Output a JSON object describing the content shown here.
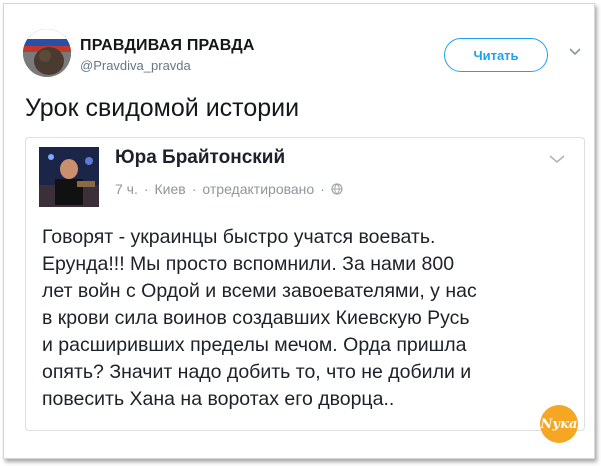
{
  "tweet": {
    "author_name": "ПРАВДИВАЯ ПРАВДА",
    "author_handle": "@Pravdiva_pravda",
    "follow_label": "Читать",
    "text": "Урок свидомой истории"
  },
  "facebook_post": {
    "author_name": "Юра Брайтонский",
    "time": "7 ч.",
    "location": "Киев",
    "edited": "отредактировано",
    "body_lines": [
      "Говорят - украинцы быстро учатся воевать.",
      "Ерунда!!! Мы просто вспомнили. За нами 800",
      "лет войн с Ордой и всеми завоевателями, у нас",
      "в крови сила воинов создавших Киевскую Русь",
      "и расширивших пределы мечом. Орда пришла",
      "опять? Значит надо добить то, что не добили и",
      "повесить Хана на воротах его дворца.."
    ]
  },
  "watermark": {
    "text": "Nука"
  },
  "colors": {
    "twitter_blue": "#1da1f2",
    "text_dark": "#14171a",
    "meta_grey": "#90949c"
  },
  "icons": [
    "chevron-down-icon",
    "globe-icon"
  ]
}
